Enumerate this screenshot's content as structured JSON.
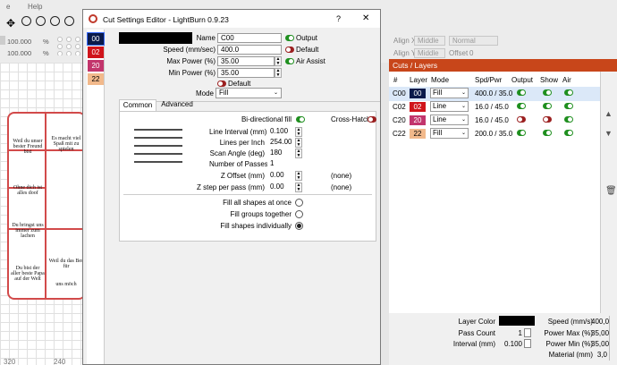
{
  "menu": {
    "help": "Help"
  },
  "toolbar": {
    "val1": "100.000",
    "val2": "100.000",
    "unit": "%"
  },
  "align": {
    "x_label": "Align X",
    "y_label": "Align Y",
    "x_value": "Middle",
    "y_value": "Middle",
    "normal": "Normal",
    "offset_label": "Offset",
    "offset_value": "0"
  },
  "rulers": {
    "r320": "320",
    "r240": "240",
    "r_bottom1": "320",
    "r_bottom2": "240"
  },
  "canvas_texts": [
    "Weil du unser bester Freund bist",
    "Es macht viel Spaß mit zu spielen",
    "Ohne dich ist alles doof",
    "Du bringst uns immer zum lachen",
    "Du bist der aller beste Papa auf der Welt",
    "Weil du das Bes für",
    "uns möch"
  ],
  "dialog": {
    "title": "Cut Settings Editor - LightBurn 0.9.23",
    "help_btn": "?",
    "close_btn": "✕",
    "layers": [
      {
        "label": "00",
        "color": "#0a1a4a"
      },
      {
        "label": "02",
        "color": "#d0141b"
      },
      {
        "label": "20",
        "color": "#c2356c"
      },
      {
        "label": "22",
        "color": "#f2b98b",
        "textcolor": "#000"
      }
    ],
    "name_label": "Name",
    "name_value": "C00",
    "output_label": "Output",
    "default_label": "Default",
    "air_assist_label": "Air Assist",
    "speed_label": "Speed (mm/sec)",
    "speed_value": "400.0",
    "max_power_label": "Max Power (%)",
    "max_power_value": "35.00",
    "min_power_label": "Min Power (%)",
    "min_power_value": "35.00",
    "default2_label": "Default",
    "mode_label": "Mode",
    "mode_value": "Fill",
    "tabs": [
      "Common",
      "Advanced"
    ],
    "bidir_label": "Bi-directional fill",
    "crosshatch_label": "Cross-Hatch",
    "interval_label": "Line Interval (mm)",
    "interval_value": "0.100",
    "lpi_label": "Lines per Inch",
    "lpi_value": "254.00",
    "scan_label": "Scan Angle (deg)",
    "scan_value": "180",
    "passes_label": "Number of Passes",
    "passes_value": "1",
    "zoffset_label": "Z Offset (mm)",
    "zoffset_value": "0.00",
    "zoffset_none": "(none)",
    "zstep_label": "Z step per pass (mm)",
    "zstep_value": "0.00",
    "zstep_none": "(none)",
    "fill_all": "Fill all shapes at once",
    "fill_groups": "Fill groups together",
    "fill_indiv": "Fill shapes individually"
  },
  "panel": {
    "title": "Cuts / Layers",
    "headers": [
      "#",
      "Layer",
      "Mode",
      "Spd/Pwr",
      "Output",
      "Show",
      "Air"
    ],
    "rows": [
      {
        "num": "C00",
        "layer": "00",
        "color": "#0a1a4a",
        "mode": "Fill",
        "sp": "400.0 / 35.0",
        "output": true,
        "show": true,
        "air": true
      },
      {
        "num": "C02",
        "layer": "02",
        "color": "#d0141b",
        "mode": "Line",
        "sp": "16.0 / 45.0",
        "output": true,
        "show": true,
        "air": true
      },
      {
        "num": "C20",
        "layer": "20",
        "color": "#c2356c",
        "mode": "Line",
        "sp": "16.0 / 45.0",
        "output": false,
        "show": false,
        "air": true
      },
      {
        "num": "C22",
        "layer": "22",
        "color": "#f2b98b",
        "mode": "Fill",
        "sp": "200.0 / 35.0",
        "output": true,
        "show": true,
        "air": true
      }
    ]
  },
  "bottom": {
    "layer_color_label": "Layer Color",
    "pass_count_label": "Pass Count",
    "pass_count_value": "1",
    "interval_label": "Interval (mm)",
    "interval_value": "0.100",
    "speed_label": "Speed (mm/s)",
    "speed_value": "400,0",
    "pmax_label": "Power Max (%)",
    "pmax_value": "35,00",
    "pmin_label": "Power Min (%)",
    "pmin_value": "35,00",
    "material_label": "Material (mm)",
    "material_value": "3,0"
  }
}
